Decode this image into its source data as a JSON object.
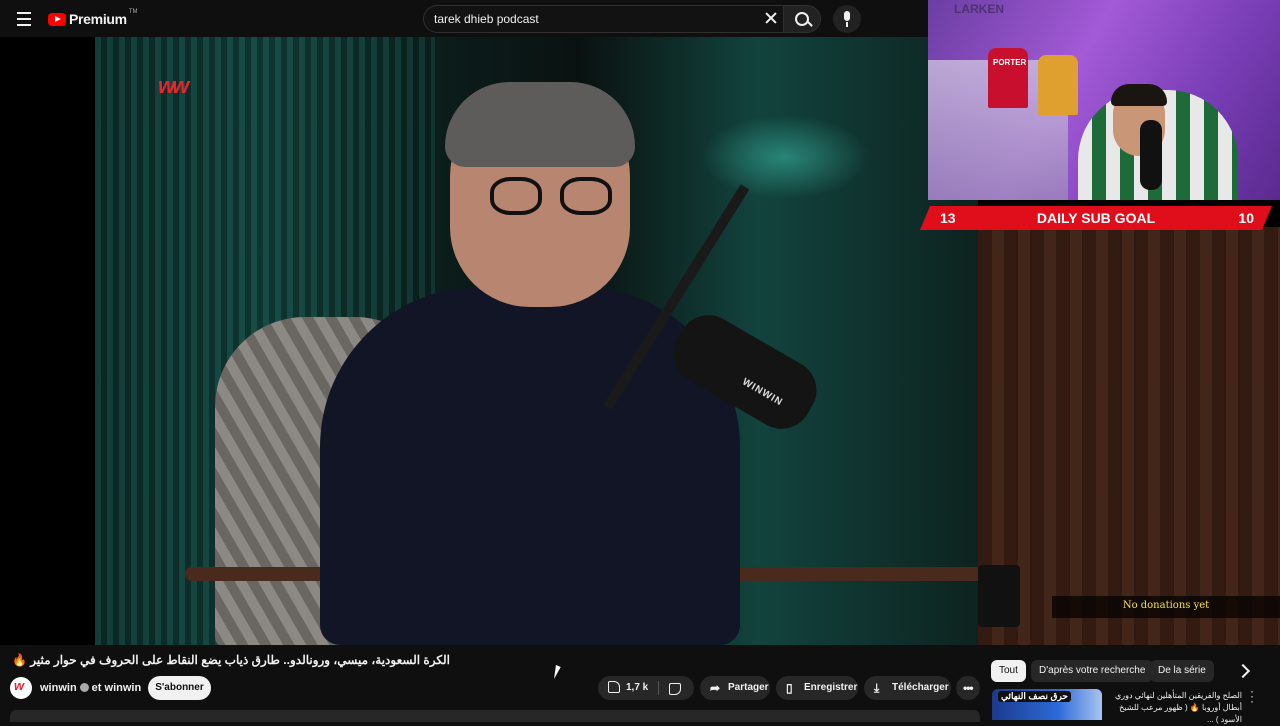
{
  "header": {
    "logo_text": "Premium",
    "logo_tm": "TM",
    "search_value": "tarek dhieb podcast"
  },
  "video": {
    "watermark": "w",
    "mic_label": "WINWIN"
  },
  "overlay": {
    "sub_goal_current": "13",
    "sub_goal_title": "DAILY SUB GOAL",
    "sub_goal_target": "10",
    "donations_text": "No donations yet",
    "cam_shirt_text": "PORTER",
    "cam_logo_text": "LARKEN"
  },
  "watch": {
    "title": "الكرة السعودية، ميسي، ورونالدو.. طارق ذياب يضع النقاط على الحروف في حوار مثير 🔥",
    "channel": "winwin",
    "channel_suffix": "et winwin",
    "subscribe_label": "S'abonner",
    "like_count": "1,7 k",
    "share_label": "Partager",
    "save_label": "Enregistrer",
    "download_label": "Télécharger"
  },
  "related": {
    "chips": [
      "Tout",
      "D'après votre recherche",
      "De la série"
    ],
    "active_chip": "Tout",
    "items": [
      {
        "thumb_text": "حرق نصف النهائي",
        "title": "الصلح والفريقين المتأهلين لنهائي دوري أبطال أوروبا 🔥 ( ظهور مرعب للشيخ الأسود ) ..."
      }
    ]
  },
  "colors": {
    "brand_red": "#ff0000",
    "sub_goal_bg": "#e00d1a",
    "donation_text": "#f4e04d",
    "page_bg": "#0f0f0f"
  },
  "icons": [
    "menu-icon",
    "youtube-logo-icon",
    "clear-icon",
    "search-icon",
    "mic-icon",
    "verified-icon",
    "like-icon",
    "dislike-icon",
    "share-icon",
    "save-icon",
    "download-icon",
    "more-icon",
    "chevron-right-icon"
  ]
}
